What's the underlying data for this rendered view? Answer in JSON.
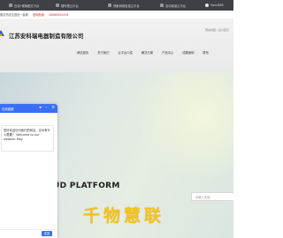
{
  "topbar": {
    "items": [
      {
        "label": "石油•钢管图文平台",
        "icon": "building-icon"
      },
      {
        "label": "随时看云平台",
        "icon": "cloud-icon"
      },
      {
        "label": "慧聚网络信息云平台",
        "icon": "info-icon"
      },
      {
        "label": "自动阅读云平台",
        "icon": "book-icon"
      },
      {
        "label": "ifonn888",
        "icon": "user-icon"
      }
    ]
  },
  "contact": {
    "prefix": "服务热线全国统一客服：",
    "hotline_label": "咨询热线：",
    "hotline": "18060555259"
  },
  "header": {
    "company": "江苏安科瑞电器制造有限公司",
    "right_note": "网站地图 | 设为首页"
  },
  "nav": {
    "items": [
      "网站首页",
      "关于我们",
      "云平台介绍",
      "解决方案",
      "产品中心",
      "成果案例",
      "联系"
    ]
  },
  "hero": {
    "cloud_text": "UD PLATFORM",
    "big_cn": [
      "千",
      "物",
      "慧",
      "联"
    ],
    "search_placeholder": "请输入关键"
  },
  "chat": {
    "title": "在线客服",
    "message": "您好欢迎访问我们的网站，请问有什么需要？ Welcome to our website. May",
    "send_label": "发送"
  }
}
